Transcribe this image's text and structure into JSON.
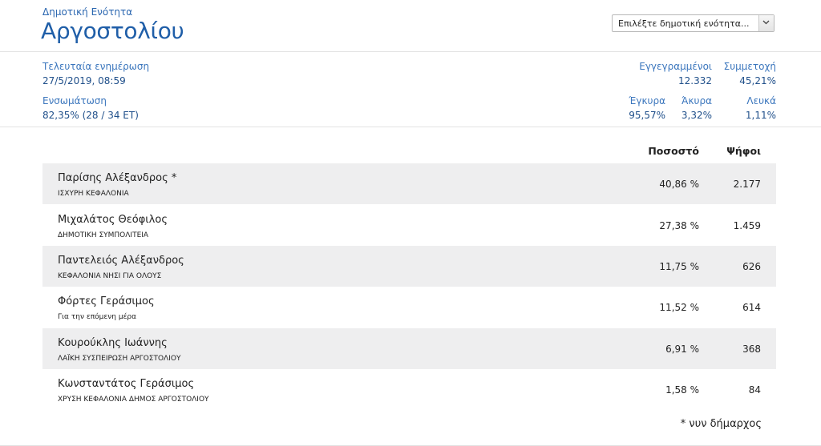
{
  "header": {
    "subtitle": "Δημοτική Ενότητα",
    "title": "Αργοστολίου",
    "select_label": "Επιλέξτε δημοτική ενότητα..."
  },
  "stats": {
    "last_update_label": "Τελευταία ενημέρωση",
    "last_update_value": "27/5/2019, 08:59",
    "incorporation_label": "Ενσωμάτωση",
    "incorporation_value": "82,35% (28 / 34 ΕΤ)",
    "registered_label": "Εγγεγραμμένοι",
    "registered_value": "12.332",
    "turnout_label": "Συμμετοχή",
    "turnout_value": "45,21%",
    "valid_label": "Έγκυρα",
    "valid_value": "95,57%",
    "invalid_label": "Άκυρα",
    "invalid_value": "3,32%",
    "blank_label": "Λευκά",
    "blank_value": "1,11%"
  },
  "table": {
    "col_percent": "Ποσοστό",
    "col_votes": "Ψήφοι",
    "rows": [
      {
        "name": "Παρίσης Αλέξανδρος *",
        "party": "ΙΣΧΥΡΗ ΚΕΦΑΛΟΝΙΑ",
        "percent": "40,86 %",
        "votes": "2.177"
      },
      {
        "name": "Μιχαλάτος Θεόφιλος",
        "party": "ΔΗΜΟΤΙΚΗ ΣΥΜΠΟΛΙΤΕΙΑ",
        "percent": "27,38 %",
        "votes": "1.459"
      },
      {
        "name": "Παντελειός Αλέξανδρος",
        "party": "ΚΕΦΑΛΟΝΙΑ ΝΗΣΙ ΓΙΑ ΟΛΟΥΣ",
        "percent": "11,75 %",
        "votes": "626"
      },
      {
        "name": "Φόρτες Γεράσιμος",
        "party": "Για την επόμενη μέρα",
        "percent": "11,52 %",
        "votes": "614"
      },
      {
        "name": "Κουρούκλης Ιωάννης",
        "party": "ΛΑΪΚΗ ΣΥΣΠΕΙΡΩΣΗ ΑΡΓΟΣΤΟΛΙΟΥ",
        "percent": "6,91 %",
        "votes": "368"
      },
      {
        "name": "Κωνσταντάτος Γεράσιμος",
        "party": "ΧΡΥΣΗ ΚΕΦΑΛΟΝΙΑ ΔΗΜΟΣ ΑΡΓΟΣΤΟΛΙΟΥ",
        "percent": "1,58 %",
        "votes": "84"
      }
    ],
    "footnote": "* νυν δήμαρχος"
  },
  "colors": {
    "title_blue": "#1f5ea8",
    "label_blue": "#3b76bd",
    "row_shade": "#eeeeef"
  },
  "icons": {
    "select_arrow": "chevron-down-icon"
  }
}
